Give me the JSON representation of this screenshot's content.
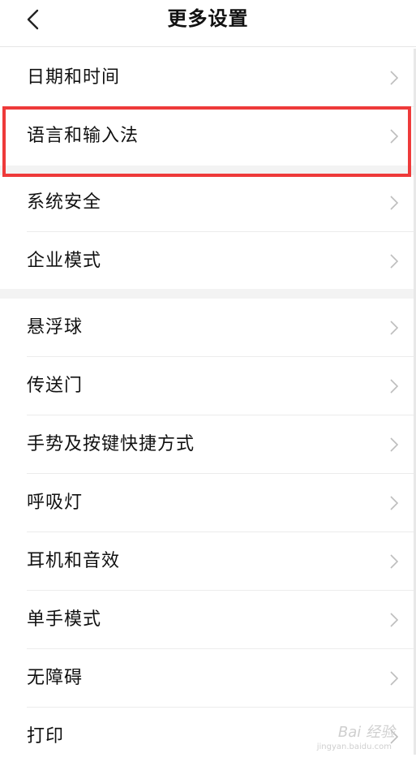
{
  "header": {
    "title": "更多设置",
    "back_icon": "chevron-left-icon"
  },
  "settings": {
    "items": [
      {
        "label": "日期和时间"
      },
      {
        "label": "语言和输入法"
      },
      {
        "label": "系统安全"
      },
      {
        "label": "企业模式"
      },
      {
        "label": "悬浮球"
      },
      {
        "label": "传送门"
      },
      {
        "label": "手势及按键快捷方式"
      },
      {
        "label": "呼吸灯"
      },
      {
        "label": "耳机和音效"
      },
      {
        "label": "单手模式"
      },
      {
        "label": "无障碍"
      },
      {
        "label": "打印"
      }
    ],
    "row_icon": "chevron-right-icon"
  },
  "highlight_color": "#ee3a3a",
  "watermark": {
    "text": "Bai 经验",
    "sub": "jingyan.baidu.com"
  }
}
